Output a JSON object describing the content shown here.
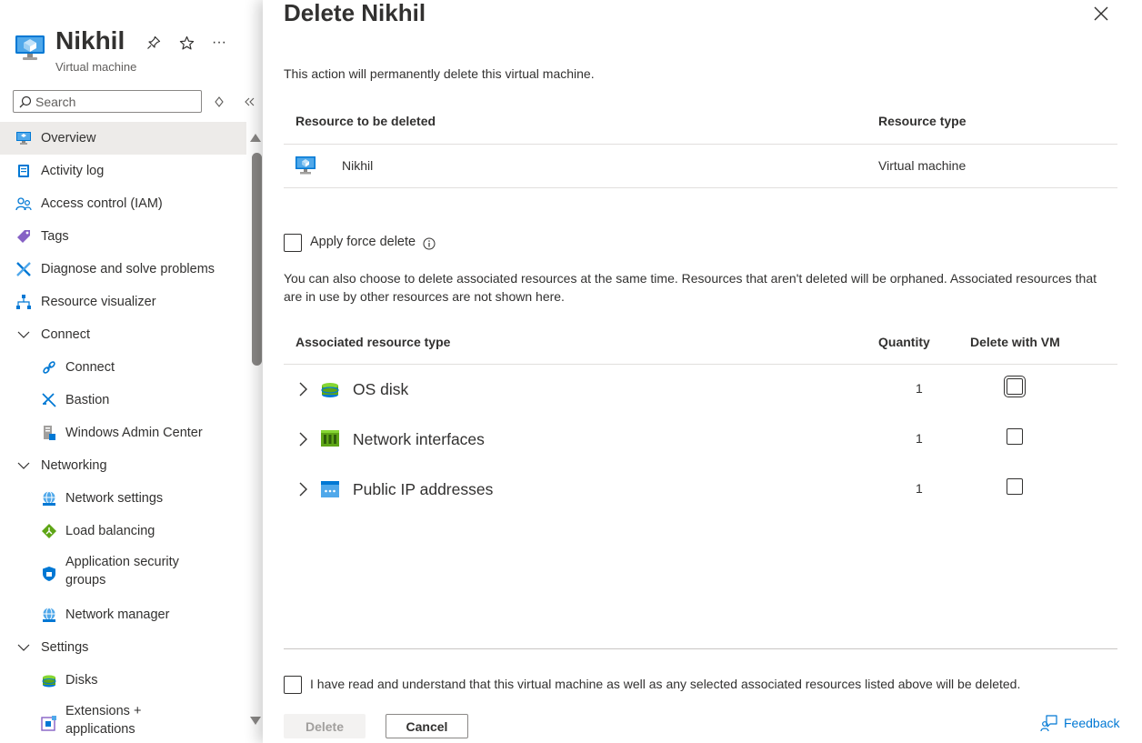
{
  "resource": {
    "name": "Nikhil",
    "type": "Virtual machine",
    "pin_icon": "pin-icon",
    "favorite_icon": "star-icon",
    "more_label": "···"
  },
  "search": {
    "placeholder": "Search"
  },
  "nav": [
    {
      "label": "Overview",
      "icon": "monitor-icon",
      "selected": true
    },
    {
      "label": "Activity log",
      "icon": "log-icon"
    },
    {
      "label": "Access control (IAM)",
      "icon": "people-icon"
    },
    {
      "label": "Tags",
      "icon": "tag-icon"
    },
    {
      "label": "Diagnose and solve problems",
      "icon": "wrench-icon"
    },
    {
      "label": "Resource visualizer",
      "icon": "hierarchy-icon"
    },
    {
      "label": "Connect",
      "icon": "chevron-down-icon",
      "group": true
    },
    {
      "label": "Connect",
      "icon": "link-icon",
      "child": true
    },
    {
      "label": "Bastion",
      "icon": "bastion-icon",
      "child": true
    },
    {
      "label": "Windows Admin Center",
      "icon": "server-icon",
      "child": true
    },
    {
      "label": "Networking",
      "icon": "chevron-down-icon",
      "group": true
    },
    {
      "label": "Network settings",
      "icon": "globe-icon",
      "child": true
    },
    {
      "label": "Load balancing",
      "icon": "load-balancer-icon",
      "child": true
    },
    {
      "label": "Application security groups",
      "icon": "shield-icon",
      "child": true
    },
    {
      "label": "Network manager",
      "icon": "globe-icon",
      "child": true
    },
    {
      "label": "Settings",
      "icon": "chevron-down-icon",
      "group": true
    },
    {
      "label": "Disks",
      "icon": "disk-icon",
      "child": true
    },
    {
      "label": "Extensions + applications",
      "icon": "extension-icon",
      "child": true
    }
  ],
  "dialog": {
    "title": "Delete Nikhil",
    "intro": "This action will permanently delete this virtual machine.",
    "table": {
      "headers": [
        "Resource to be deleted",
        "Resource type"
      ],
      "row": {
        "name": "Nikhil",
        "type": "Virtual machine",
        "icon": "vm-icon"
      }
    },
    "force_delete": {
      "label": "Apply force delete",
      "checked": false,
      "icon": "info-icon"
    },
    "description": "You can also choose to delete associated resources at the same time. Resources that aren't deleted will be orphaned. Associated resources that are in use by other resources are not shown here.",
    "assoc": {
      "headers": [
        "Associated resource type",
        "Quantity",
        "Delete with VM"
      ],
      "rows": [
        {
          "name": "OS disk",
          "quantity": "1",
          "icon": "disk-icon",
          "checked": false
        },
        {
          "name": "Network interfaces",
          "quantity": "1",
          "icon": "nic-icon",
          "checked": false
        },
        {
          "name": "Public IP addresses",
          "quantity": "1",
          "icon": "public-ip-icon",
          "checked": false
        }
      ]
    },
    "acknowledge": "I have read and understand that this virtual machine as well as any selected associated resources listed above will be deleted.",
    "delete_label": "Delete",
    "cancel_label": "Cancel",
    "feedback_label": "Feedback"
  },
  "colors": {
    "link": "#0078d4",
    "selected_bg": "#edebe9",
    "text": "#323130",
    "disabled_text": "#a19f9d"
  }
}
